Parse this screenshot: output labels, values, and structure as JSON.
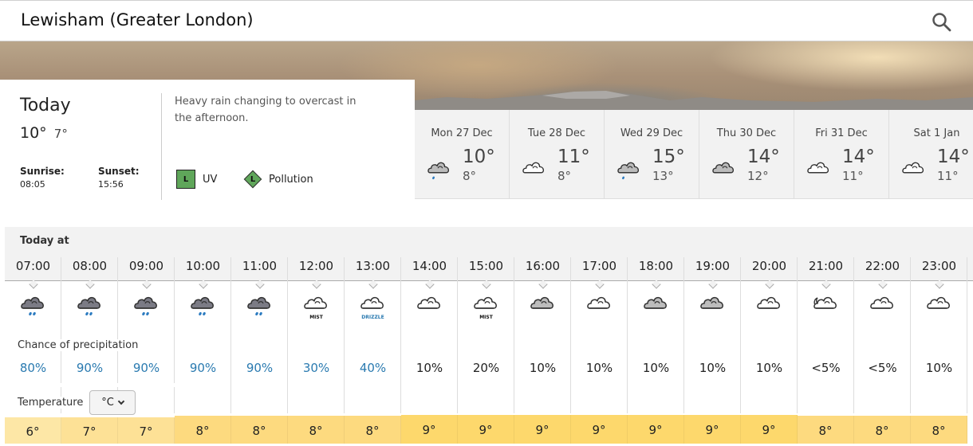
{
  "header": {
    "title": "Lewisham (Greater London)",
    "search_icon": "search-icon"
  },
  "today": {
    "label": "Today",
    "high": "10°",
    "low": "7°",
    "sunrise_label": "Sunrise:",
    "sunrise": "08:05",
    "sunset_label": "Sunset:",
    "sunset": "15:56",
    "summary": "Heavy rain changing to overcast in the afternoon.",
    "uv_level": "L",
    "uv_label": "UV",
    "pollution_level": "L",
    "pollution_label": "Pollution",
    "badge_color": "#5fa65a"
  },
  "days": [
    {
      "name": "Mon 27 Dec",
      "high": "10°",
      "low": "8°",
      "icon": "light-rain-grey-cloud-icon"
    },
    {
      "name": "Tue 28 Dec",
      "high": "11°",
      "low": "8°",
      "icon": "white-cloud-icon"
    },
    {
      "name": "Wed 29 Dec",
      "high": "15°",
      "low": "13°",
      "icon": "light-rain-grey-cloud-icon"
    },
    {
      "name": "Thu 30 Dec",
      "high": "14°",
      "low": "12°",
      "icon": "grey-cloud-icon"
    },
    {
      "name": "Fri 31 Dec",
      "high": "14°",
      "low": "11°",
      "icon": "white-cloud-icon"
    },
    {
      "name": "Sat 1 Jan",
      "high": "14°",
      "low": "11°",
      "icon": "white-cloud-icon"
    }
  ],
  "hourly": {
    "heading": "Today at",
    "precip_label": "Chance of precipitation",
    "temp_label": "Temperature",
    "unit": "°C",
    "hours": [
      {
        "time": "07:00",
        "icon": "heavy-rain-icon",
        "note": "",
        "precip": "80%",
        "temp": "6°"
      },
      {
        "time": "08:00",
        "icon": "heavy-rain-icon",
        "note": "",
        "precip": "90%",
        "temp": "7°"
      },
      {
        "time": "09:00",
        "icon": "heavy-rain-icon",
        "note": "",
        "precip": "90%",
        "temp": "7°"
      },
      {
        "time": "10:00",
        "icon": "heavy-rain-icon",
        "note": "",
        "precip": "90%",
        "temp": "8°"
      },
      {
        "time": "11:00",
        "icon": "heavy-rain-icon",
        "note": "",
        "precip": "90%",
        "temp": "8°"
      },
      {
        "time": "12:00",
        "icon": "mist-icon",
        "note": "MIST",
        "precip": "30%",
        "temp": "8°"
      },
      {
        "time": "13:00",
        "icon": "drizzle-icon",
        "note": "DRIZZLE",
        "precip": "40%",
        "temp": "8°"
      },
      {
        "time": "14:00",
        "icon": "white-cloud-icon",
        "note": "",
        "precip": "10%",
        "temp": "9°"
      },
      {
        "time": "15:00",
        "icon": "mist-icon",
        "note": "MIST",
        "precip": "20%",
        "temp": "9°"
      },
      {
        "time": "16:00",
        "icon": "grey-cloud-icon",
        "note": "",
        "precip": "10%",
        "temp": "9°"
      },
      {
        "time": "17:00",
        "icon": "white-cloud-icon",
        "note": "",
        "precip": "10%",
        "temp": "9°"
      },
      {
        "time": "18:00",
        "icon": "grey-cloud-icon",
        "note": "",
        "precip": "10%",
        "temp": "9°"
      },
      {
        "time": "19:00",
        "icon": "grey-cloud-icon",
        "note": "",
        "precip": "10%",
        "temp": "9°"
      },
      {
        "time": "20:00",
        "icon": "white-cloud-icon",
        "note": "",
        "precip": "10%",
        "temp": "9°"
      },
      {
        "time": "21:00",
        "icon": "partly-cloudy-night-icon",
        "note": "",
        "precip": "<5%",
        "temp": "8°"
      },
      {
        "time": "22:00",
        "icon": "white-cloud-icon",
        "note": "",
        "precip": "<5%",
        "temp": "8°"
      },
      {
        "time": "23:00",
        "icon": "white-cloud-icon",
        "note": "",
        "precip": "10%",
        "temp": "8°"
      }
    ]
  },
  "colors": {
    "precip_high": "#2a7ab0",
    "precip_low": "#222222",
    "drizzle_text": "#2a7ab0",
    "temp_6": "#fde7a6",
    "temp_7": "#fde196",
    "temp_8": "#fdda7f",
    "temp_9": "#fdd86c",
    "temp_8_evening": "#fdda7f"
  }
}
